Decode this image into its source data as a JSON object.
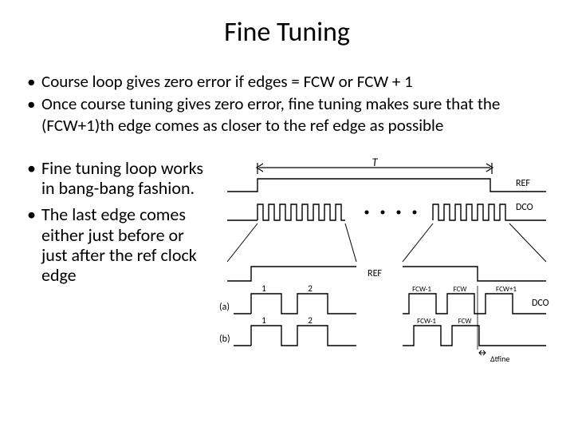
{
  "title": "Fine Tuning",
  "bullets_top": [
    "Course loop gives zero error if edges = FCW or FCW + 1",
    "Once course tuning gives zero error, fine tuning makes sure that the (FCW+1)th edge comes as closer to the ref edge as possible"
  ],
  "bullets_left": [
    "Fine tuning loop works in bang-bang fashion.",
    "The last edge comes either just before or just after the ref clock edge"
  ],
  "diagram": {
    "top_label": "T",
    "signals_upper": [
      "REF",
      "DCO"
    ],
    "signals_lower": [
      "REF",
      "DCO"
    ],
    "section_labels": [
      "(a)",
      "(b)"
    ],
    "pulse_numbers_left": [
      "1",
      "2"
    ],
    "pulse_labels_right_a": [
      "FCW-1",
      "FCW",
      "FCW+1"
    ],
    "pulse_labels_right_b": [
      "FCW-1",
      "FCW"
    ],
    "delta_label": "Δtfine"
  }
}
